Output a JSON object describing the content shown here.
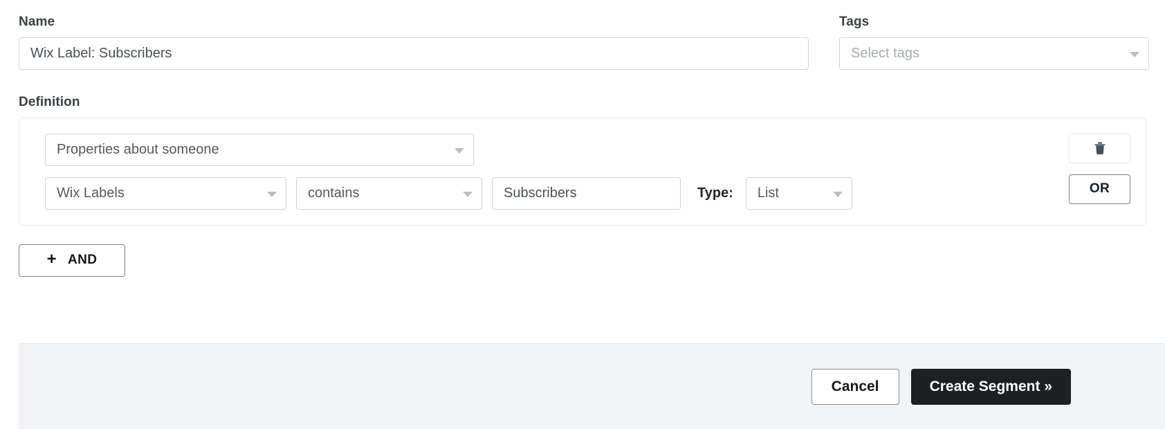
{
  "form": {
    "name": {
      "label": "Name",
      "value": "Wix Label: Subscribers",
      "placeholder": "Name"
    },
    "tags": {
      "label": "Tags",
      "value": "Select tags",
      "placeholder": "Select tags"
    }
  },
  "definition": {
    "label": "Definition",
    "scope_select": {
      "value": "Properties about someone"
    },
    "condition": {
      "field_select": "Wix Labels",
      "operator_select": "contains",
      "value_input": "Subscribers",
      "type_label": "Type:",
      "type_select": "List"
    },
    "row_actions": {
      "delete_icon": "trash-icon",
      "or_label": "OR"
    },
    "add_and": {
      "plus": "+",
      "label": "AND"
    }
  },
  "footer": {
    "cancel_label": "Cancel",
    "create_label": "Create Segment »"
  },
  "colors": {
    "primary_button_bg": "#1d2023",
    "footer_bg": "#f2f3f5",
    "input_border": "#cfd4d9",
    "placeholder_text": "#a7acb3"
  }
}
